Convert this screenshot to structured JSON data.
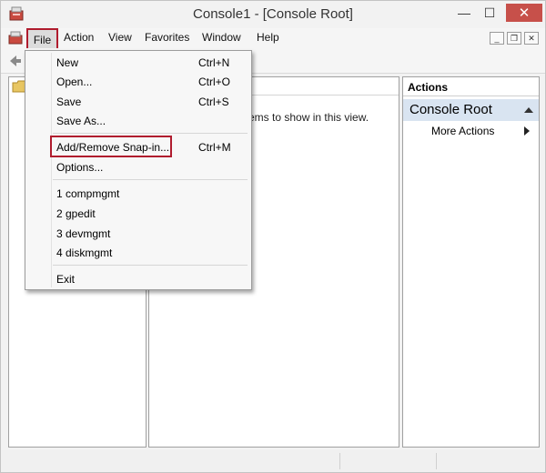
{
  "window": {
    "title": "Console1 - [Console Root]",
    "close_glyph": "✕",
    "minimize_glyph": "—",
    "maximize_glyph": "☐"
  },
  "menubar": {
    "items": [
      {
        "label": "File"
      },
      {
        "label": "Action"
      },
      {
        "label": "View"
      },
      {
        "label": "Favorites"
      },
      {
        "label": "Window"
      },
      {
        "label": "Help"
      }
    ],
    "mdi": {
      "minimize": "_",
      "restore": "❐",
      "close": "✕"
    }
  },
  "file_menu": {
    "items": [
      {
        "label": "New",
        "shortcut": "Ctrl+N"
      },
      {
        "label": "Open...",
        "shortcut": "Ctrl+O"
      },
      {
        "label": "Save",
        "shortcut": "Ctrl+S"
      },
      {
        "label": "Save As...",
        "shortcut": ""
      },
      {
        "label": "Add/Remove Snap-in...",
        "shortcut": "Ctrl+M"
      },
      {
        "label": "Options...",
        "shortcut": ""
      },
      {
        "label": "1 compmgmt",
        "shortcut": ""
      },
      {
        "label": "2 gpedit",
        "shortcut": ""
      },
      {
        "label": "3 devmgmt",
        "shortcut": ""
      },
      {
        "label": "4 diskmgmt",
        "shortcut": ""
      },
      {
        "label": "Exit",
        "shortcut": ""
      }
    ]
  },
  "center": {
    "empty_message": "ems to show in this view."
  },
  "actions": {
    "header": "Actions",
    "group": "Console Root",
    "more": "More Actions"
  },
  "colors": {
    "highlight_border": "#b01c2e",
    "close_button": "#c7504a",
    "actions_group_bg": "#d9e4f1"
  }
}
